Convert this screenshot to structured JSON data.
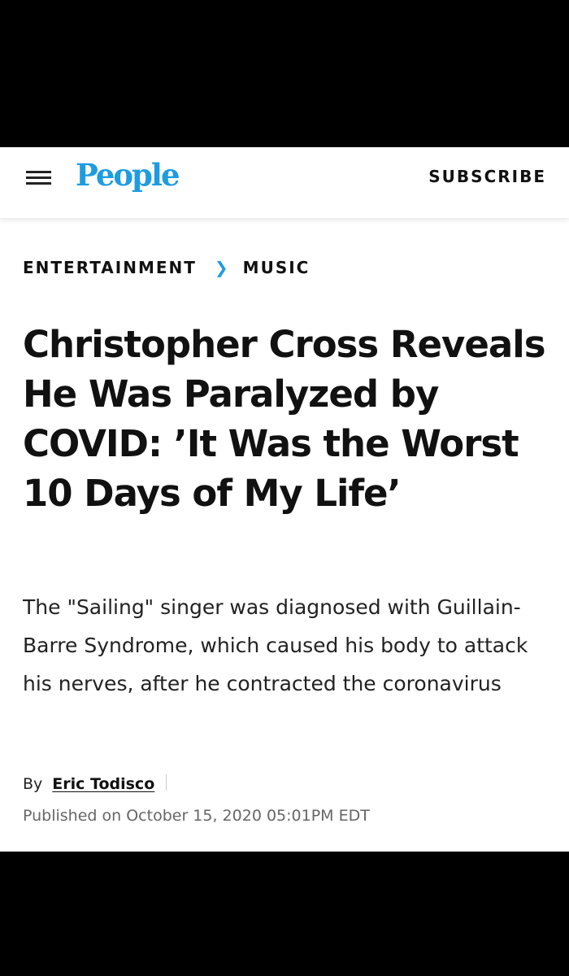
{
  "header": {
    "logo": "People",
    "subscribe_label": "SUBSCRIBE",
    "brand_color": "#1e9ce0"
  },
  "breadcrumb": {
    "items": [
      "ENTERTAINMENT",
      "MUSIC"
    ],
    "separator_icon": "chevron-right-icon"
  },
  "article": {
    "headline": "Christopher Cross Reveals He Was Paralyzed by COVID: ’It Was the Worst 10 Days of My Life’",
    "dek": "The \"Sailing\" singer was diagnosed with Guillain-Barre Syndrome, which caused his body to attack his nerves, after he contracted the coronavirus",
    "byline_prefix": "By",
    "author": "Eric Todisco",
    "published": "Published on October 15, 2020 05:01PM EDT"
  }
}
